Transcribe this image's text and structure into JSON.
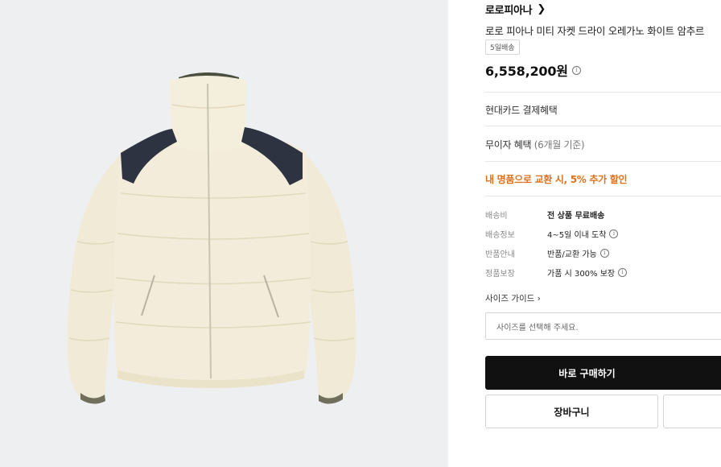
{
  "product": {
    "brand": "로로피아나",
    "name": "로로 피아나 미티 자켓 드라이 오레가노 화이트 암추르",
    "delivery_badge": "5일배송",
    "price": "6,558,200원",
    "image_alt": "cream puffer jacket with navy shoulder panels"
  },
  "benefits": {
    "card": "현대카드 결제혜택",
    "installment_main": "무이자 혜택",
    "installment_sub": "(6개월 기준)",
    "promo": "내 명품으로 교환 시, 5% 추가 할인"
  },
  "specs": [
    {
      "key": "배송비",
      "value": "전 상품 무료배송"
    },
    {
      "key": "배송정보",
      "value": "4~5일 이내 도착"
    },
    {
      "key": "반품안내",
      "value": "반품/교환 가능"
    },
    {
      "key": "정품보장",
      "value": "가품 시 300% 보장"
    }
  ],
  "size": {
    "guide_label": "사이즈 가이드",
    "placeholder": "사이즈를 선택해 주세요."
  },
  "actions": {
    "buy": "바로 구매하기",
    "cart": "장바구니"
  },
  "colors": {
    "promo": "#e0701a",
    "buy_button": "#111111",
    "gallery_bg": "#eeeff1"
  },
  "icons": [
    "chevron-right-icon",
    "info-icon"
  ]
}
